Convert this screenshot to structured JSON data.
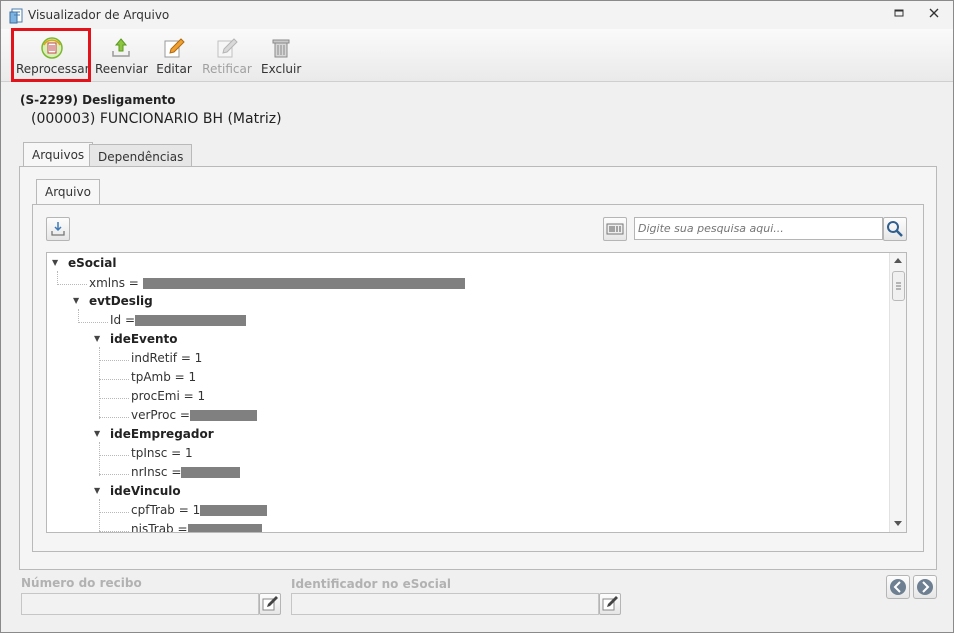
{
  "window": {
    "title": "Visualizador de Arquivo"
  },
  "toolbar": {
    "reprocessar": "Reprocessar",
    "reenviar": "Reenviar",
    "editar": "Editar",
    "retificar": "Retificar",
    "excluir": "Excluir"
  },
  "header": {
    "event": "(S-2299) Desligamento",
    "employee": "(000003) FUNCIONARIO BH (Matriz)"
  },
  "tabs": {
    "arquivos": "Arquivos",
    "dependencias": "Dependências"
  },
  "subtab": {
    "arquivo": "Arquivo"
  },
  "search": {
    "placeholder": "Digite sua pesquisa aqui..."
  },
  "tree": {
    "esocial": "eSocial",
    "xmlns": "xmlns =",
    "evtdeslig": "evtDeslig",
    "id": "Id =",
    "ideevento": "ideEvento",
    "indretif": "indRetif = 1",
    "tpamb": "tpAmb = 1",
    "procemi": "procEmi = 1",
    "verproc": "verProc =",
    "ideempregador": "ideEmpregador",
    "tpinsc": "tpInsc = 1",
    "nrinsc": "nrInsc =",
    "idevinculo": "ideVinculo",
    "cpftrab": "cpfTrab = 1",
    "nistrab": "nisTrab ="
  },
  "footer": {
    "recibo_label": "Número do recibo",
    "recibo_value": "",
    "identificador_label": "Identificador no eSocial",
    "identificador_value": ""
  }
}
